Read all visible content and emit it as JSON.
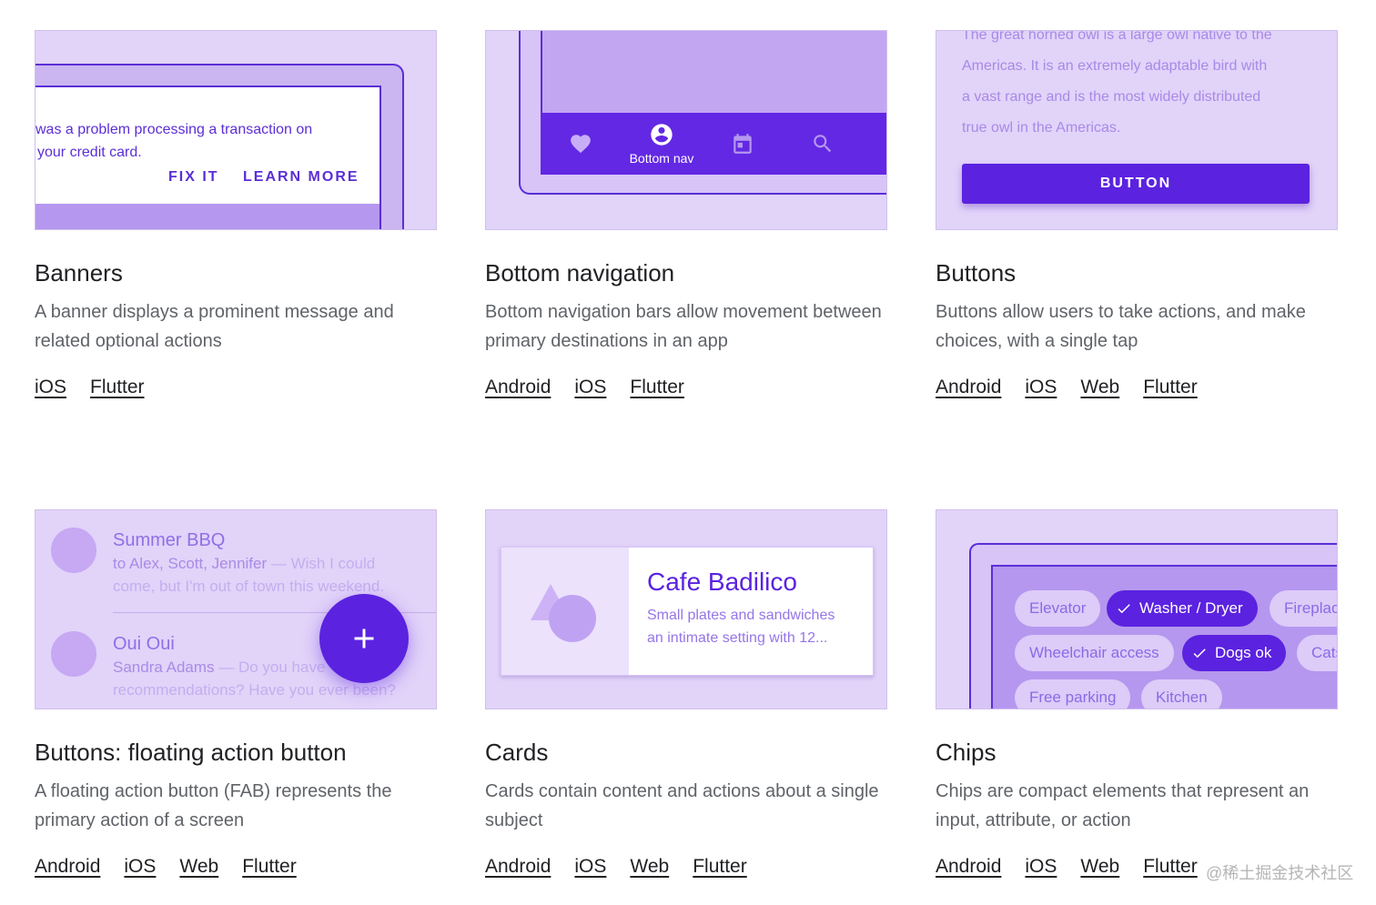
{
  "components": [
    {
      "title": "Banners",
      "description": "A banner displays a prominent message and related optional actions",
      "links": [
        "iOS",
        "Flutter"
      ],
      "preview": {
        "message_line1": "was a problem processing a transaction on",
        "message_line2": "your credit card.",
        "action_primary": "FIX IT",
        "action_secondary": "LEARN MORE"
      }
    },
    {
      "title": "Bottom navigation",
      "description": "Bottom navigation bars allow movement between primary destinations in an app",
      "links": [
        "Android",
        "iOS",
        "Flutter"
      ],
      "preview": {
        "active_label": "Bottom nav",
        "icons": [
          "heart-icon",
          "account-circle-icon",
          "calendar-icon",
          "search-icon"
        ]
      }
    },
    {
      "title": "Buttons",
      "description": "Buttons allow users to take actions, and make choices, with a single tap",
      "links": [
        "Android",
        "iOS",
        "Web",
        "Flutter"
      ],
      "preview": {
        "text_lines": [
          "The great horned owl is a large owl native to the",
          "Americas. It is an extremely adaptable bird with",
          "a vast range and is the most widely distributed",
          "true owl in the Americas."
        ],
        "button_label": "BUTTON"
      }
    },
    {
      "title": "Buttons: floating action button",
      "description": "A floating action button (FAB) represents the primary action of a screen",
      "links": [
        "Android",
        "iOS",
        "Web",
        "Flutter"
      ],
      "preview": {
        "item1_title": "Summer BBQ",
        "item1_people": "to Alex, Scott, Jennifer",
        "item1_snippet": "— Wish I could",
        "item1_snippet2": "come, but I'm out of town this weekend.",
        "item2_title": "Oui Oui",
        "item2_people": "Sandra Adams",
        "item2_snippet": "— Do you have",
        "item2_snippet2": "recommendations? Have you ever been?",
        "fab_icon": "plus-icon"
      }
    },
    {
      "title": "Cards",
      "description": "Cards contain content and actions about a single subject",
      "links": [
        "Android",
        "iOS",
        "Web",
        "Flutter"
      ],
      "preview": {
        "card_title": "Cafe Badilico",
        "card_line1": "Small plates and sandwiches",
        "card_line2": "an intimate setting with 12..."
      }
    },
    {
      "title": "Chips",
      "description": "Chips are compact elements that represent an input, attribute, or action",
      "links": [
        "Android",
        "iOS",
        "Web",
        "Flutter"
      ],
      "preview": {
        "chips": [
          "Elevator",
          "Washer / Dryer",
          "Fireplac",
          "Wheelchair access",
          "Dogs ok",
          "Cats",
          "Free parking",
          "Kitchen"
        ]
      }
    }
  ],
  "watermark": "@稀土掘金技术社区",
  "colors": {
    "thumb_bg": "#e2d3f9",
    "primary": "#5b22e0",
    "text_primary": "#202124",
    "text_secondary": "#5f6368"
  }
}
